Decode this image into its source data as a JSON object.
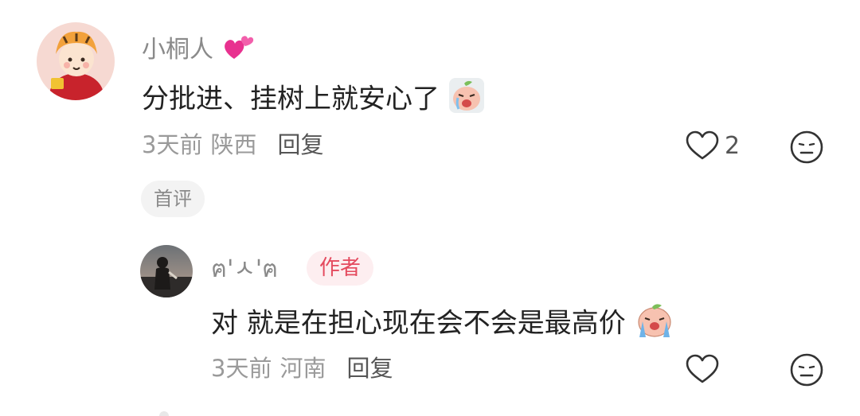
{
  "comments": [
    {
      "username": "小桐人",
      "username_emoji": "two-hearts-icon",
      "text": "分批进、挂树上就安心了",
      "text_emoji": "crying-peach-face-sticker",
      "time": "3天前",
      "region": "陕西",
      "reply_label": "回复",
      "like_count": "2",
      "badge": "首评"
    },
    {
      "username": "ฅ'ㅅ'ฅ",
      "author_tag": "作者",
      "text": "对 就是在担心现在会不会是最高价",
      "text_emoji": "crying-peach-face-sticker",
      "time": "3天前",
      "region": "河南",
      "reply_label": "回复",
      "like_count": ""
    }
  ],
  "colors": {
    "author_tag_bg": "#fdeef0",
    "author_tag_text": "#e44a5e",
    "meta_text": "#9a9a9a",
    "username_text": "#8a8a8a"
  }
}
